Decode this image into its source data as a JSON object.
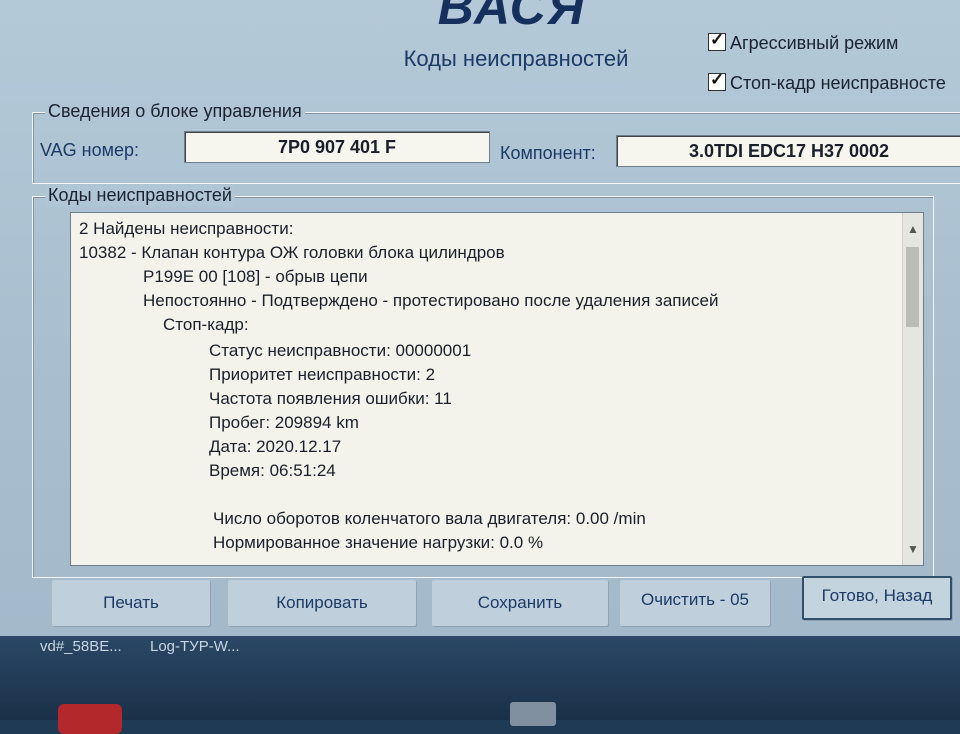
{
  "app": {
    "logo": "ВАСЯ",
    "subtitle": "Коды неисправностей"
  },
  "options": {
    "aggressive_mode": {
      "label": "Агрессивный режим",
      "checked": true
    },
    "freeze_frame": {
      "label": "Стоп-кадр неисправносте",
      "checked": true
    }
  },
  "ecu": {
    "legend": "Сведения о блоке управления",
    "vag_label": "VAG номер:",
    "vag_value": "7P0 907 401 F",
    "component_label": "Компонент:",
    "component_value": "3.0TDI EDC17  H37 0002"
  },
  "dtc": {
    "legend": "Коды неисправностей",
    "lines": [
      "2 Найдены неисправности:",
      "10382 - Клапан контура ОЖ головки блока цилиндров",
      "P199E 00 [108] - обрыв цепи",
      "Непостоянно - Подтверждено - протестировано после удаления записей",
      "Стоп-кадр:",
      "Статус неисправности: 00000001",
      "Приоритет неисправности: 2",
      "Частота появления ошибки: 11",
      "Пробег: 209894 km",
      "Дата: 2020.12.17",
      "Время: 06:51:24",
      "Число оборотов коленчатого вала двигателя: 0.00 /min",
      "Нормированное значение нагрузки: 0.0 %"
    ]
  },
  "buttons": {
    "print": "Печать",
    "copy": "Копировать",
    "save": "Сохранить",
    "clear": "Очистить - 05",
    "done": "Готово, Назад"
  },
  "taskbar": {
    "item1": "vd#_58BE...",
    "item2": "Log-ТУР-W..."
  },
  "icons": {
    "checkbox": "checkmark-icon",
    "scroll_up": "chevron-up-icon",
    "scroll_down": "chevron-down-icon"
  }
}
